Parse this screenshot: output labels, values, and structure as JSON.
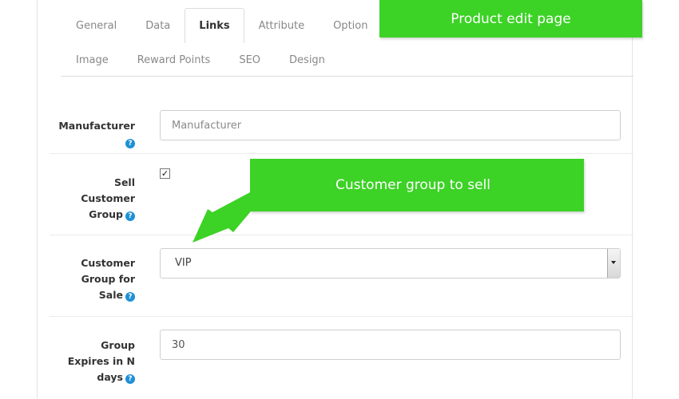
{
  "tabs": {
    "row1": [
      "General",
      "Data",
      "Links",
      "Attribute",
      "Option"
    ],
    "row2": [
      "Image",
      "Reward Points",
      "SEO",
      "Design"
    ],
    "active": "Links"
  },
  "form": {
    "manufacturer": {
      "label": "Manufacturer",
      "placeholder": "Manufacturer",
      "value": ""
    },
    "sell_customer_group": {
      "label_lines": [
        "Sell",
        "Customer",
        "Group"
      ],
      "checked": true,
      "check_glyph": "✓"
    },
    "customer_group_for_sale": {
      "label_lines": [
        "Customer",
        "Group for",
        "Sale"
      ],
      "selected": "VIP"
    },
    "group_expires": {
      "label_lines": [
        "Group",
        "Expires in N",
        "days"
      ],
      "value": "30"
    }
  },
  "help_icon_glyph": "?",
  "annotations": {
    "product_edit_page": "Product edit page",
    "customer_group_to_sell": "Customer group to sell"
  },
  "colors": {
    "annotation_green": "#3cd226",
    "help_blue": "#1f90d6"
  }
}
